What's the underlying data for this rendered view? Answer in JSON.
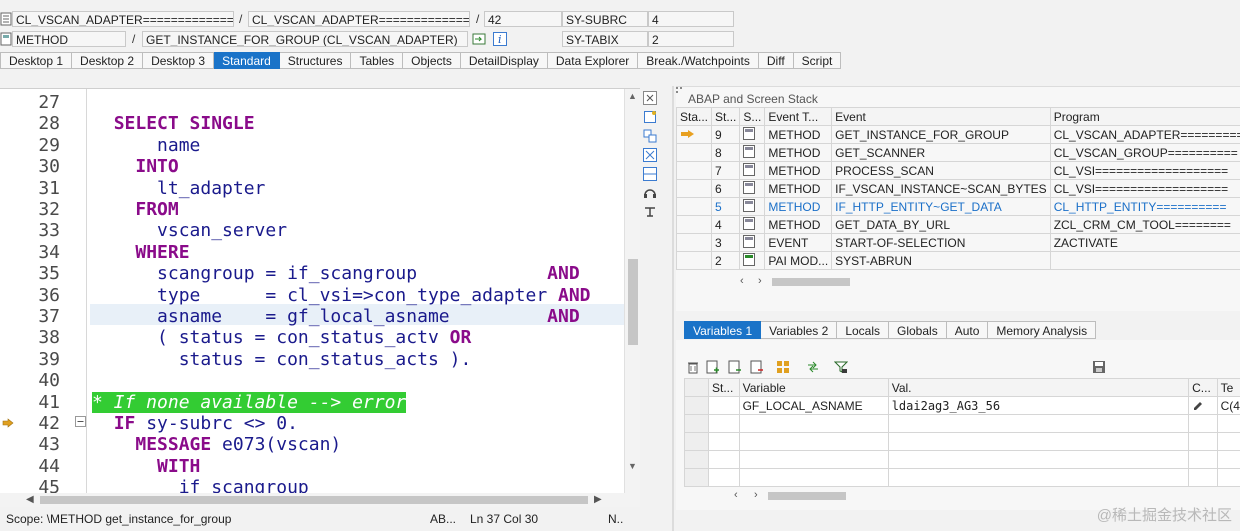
{
  "header": {
    "row1": {
      "class_name": "CL_VSCAN_ADAPTER=============_",
      "sep1": "/",
      "include_name": "CL_VSCAN_ADAPTER=============_",
      "sep2": "/",
      "line_no": "42",
      "sy_subrc_label": "SY-SUBRC",
      "sy_subrc_value": "4"
    },
    "row2": {
      "type": "METHOD",
      "sep": "/",
      "event_name": "GET_INSTANCE_FOR_GROUP (CL_VSCAN_ADAPTER)",
      "sy_tabix_label": "SY-TABIX",
      "sy_tabix_value": "2"
    }
  },
  "tabs": [
    "Desktop 1",
    "Desktop 2",
    "Desktop 3",
    "Standard",
    "Structures",
    "Tables",
    "Objects",
    "DetailDisplay",
    "Data Explorer",
    "Break./Watchpoints",
    "Diff",
    "Script"
  ],
  "active_tab": "Standard",
  "editor": {
    "lines": [
      {
        "no": "27",
        "html": ""
      },
      {
        "no": "28",
        "html": "  <span class='kw'>SELECT SINGLE</span>"
      },
      {
        "no": "29",
        "html": "      name"
      },
      {
        "no": "30",
        "html": "    <span class='kw'>INTO</span>"
      },
      {
        "no": "31",
        "html": "      lt_adapter"
      },
      {
        "no": "32",
        "html": "    <span class='kw'>FROM</span>"
      },
      {
        "no": "33",
        "html": "      vscan_server"
      },
      {
        "no": "34",
        "html": "    <span class='kw'>WHERE</span>"
      },
      {
        "no": "35",
        "html": "      scangroup = if_scangroup            <span class='kw'>AND</span>"
      },
      {
        "no": "36",
        "html": "      type      = cl_vsi=>con_type_adapter <span class='kw'>AND</span>"
      },
      {
        "no": "37",
        "html": "      asname    = gf_local_asname         <span class='kw'>AND</span>"
      },
      {
        "no": "38",
        "html": "      ( status = con_status_actv <span class='kw'>OR</span>"
      },
      {
        "no": "39",
        "html": "        status = con_status_acts )."
      },
      {
        "no": "40",
        "html": ""
      },
      {
        "no": "41",
        "html": "<span class='cmt'>* If none available --> error</span>"
      },
      {
        "no": "42",
        "html": "  <span class='kw'>IF</span> sy-subrc &lt;&gt; 0."
      },
      {
        "no": "43",
        "html": "    <span class='kw'>MESSAGE</span> e073(vscan)"
      },
      {
        "no": "44",
        "html": "      <span class='kw'>WITH</span>"
      },
      {
        "no": "45",
        "html": "        if_scangroup"
      }
    ]
  },
  "status_bar": {
    "scope": "Scope: \\METHOD get_instance_for_group",
    "mode": "AB...",
    "position": "Ln  37 Col  30",
    "extra": "N.."
  },
  "stack": {
    "title": "ABAP and Screen Stack",
    "columns": [
      "Sta...",
      "St...",
      "S...",
      "Event T...",
      "Event",
      "Program"
    ],
    "rows": [
      {
        "step": "9",
        "type": "METHOD",
        "event": "GET_INSTANCE_FOR_GROUP",
        "program": "CL_VSCAN_ADAPTER=========",
        "current": true
      },
      {
        "step": "8",
        "type": "METHOD",
        "event": "GET_SCANNER",
        "program": "CL_VSCAN_GROUP=========="
      },
      {
        "step": "7",
        "type": "METHOD",
        "event": "PROCESS_SCAN",
        "program": "CL_VSI==================="
      },
      {
        "step": "6",
        "type": "METHOD",
        "event": "IF_VSCAN_INSTANCE~SCAN_BYTES",
        "program": "CL_VSI==================="
      },
      {
        "step": "5",
        "type": "METHOD",
        "event": "IF_HTTP_ENTITY~GET_DATA",
        "program": "CL_HTTP_ENTITY==========",
        "link": true
      },
      {
        "step": "4",
        "type": "METHOD",
        "event": "GET_DATA_BY_URL",
        "program": "ZCL_CRM_CM_TOOL========"
      },
      {
        "step": "3",
        "type": "EVENT",
        "event": "START-OF-SELECTION",
        "program": "ZACTIVATE"
      },
      {
        "step": "2",
        "type": "PAI MOD...",
        "event": "SYST-ABRUN",
        "program": ""
      }
    ]
  },
  "variables": {
    "tabs": [
      "Variables 1",
      "Variables 2",
      "Locals",
      "Globals",
      "Auto",
      "Memory Analysis"
    ],
    "active_tab": "Variables 1",
    "columns": [
      "St...",
      "Variable",
      "Val.",
      "C...",
      "Te"
    ],
    "rows": [
      {
        "variable": "GF_LOCAL_ASNAME",
        "value": "ldai2ag3_AG3_56",
        "c": "",
        "te": "C(4"
      }
    ]
  },
  "watermark": "@稀土掘金技术社区",
  "colors": {
    "accent": "#1a73c8",
    "keyword": "#8a0b8a",
    "comment_bg": "#33cc33"
  }
}
